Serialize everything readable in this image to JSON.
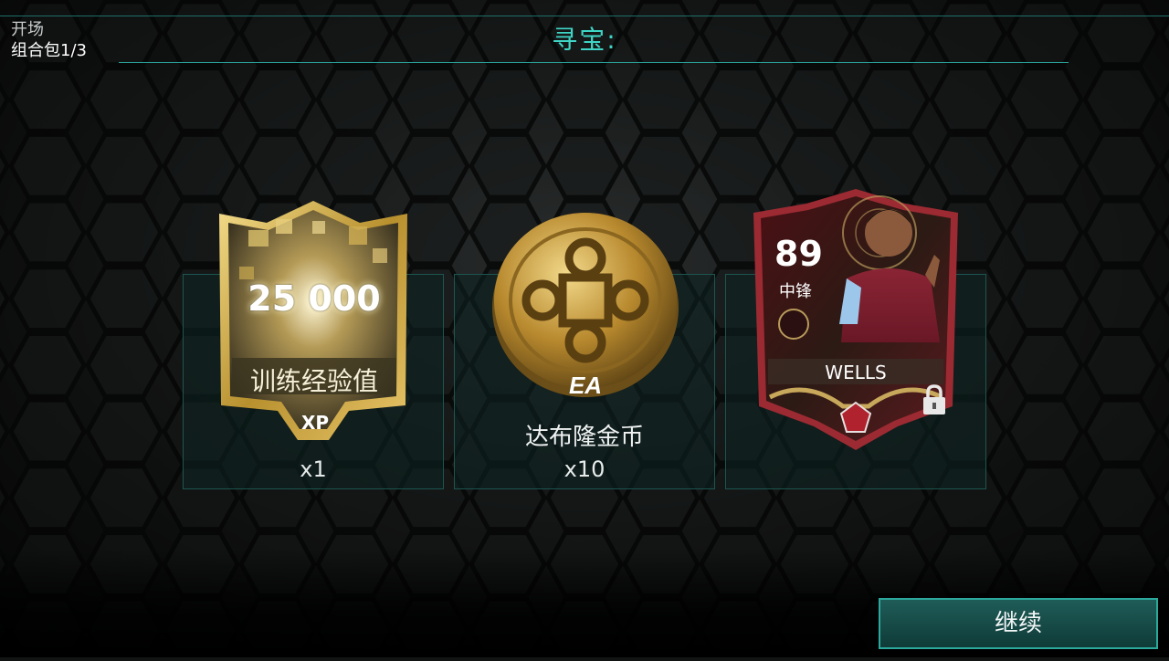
{
  "header": {
    "mode": "开场",
    "pack_progress": "组合包1/3",
    "title": "寻宝:"
  },
  "rewards": [
    {
      "type": "xp",
      "card_value": "25 000",
      "card_label": "训练经验值",
      "badge": "XP",
      "quantity": "x1"
    },
    {
      "type": "coins",
      "icon": "gold-coin-icon",
      "name": "达布隆金币",
      "quantity": "x10"
    },
    {
      "type": "player",
      "rating": "89",
      "position": "中锋",
      "player_name": "WELLS",
      "locked": true,
      "icon": "lock-icon"
    }
  ],
  "footer": {
    "continue_label": "继续"
  },
  "colors": {
    "accent": "#3fd5c6",
    "button_border": "#2ca89c",
    "panel_border": "#1d5650",
    "gold": "#c9a646",
    "player_card_red": "#7a1c22"
  }
}
